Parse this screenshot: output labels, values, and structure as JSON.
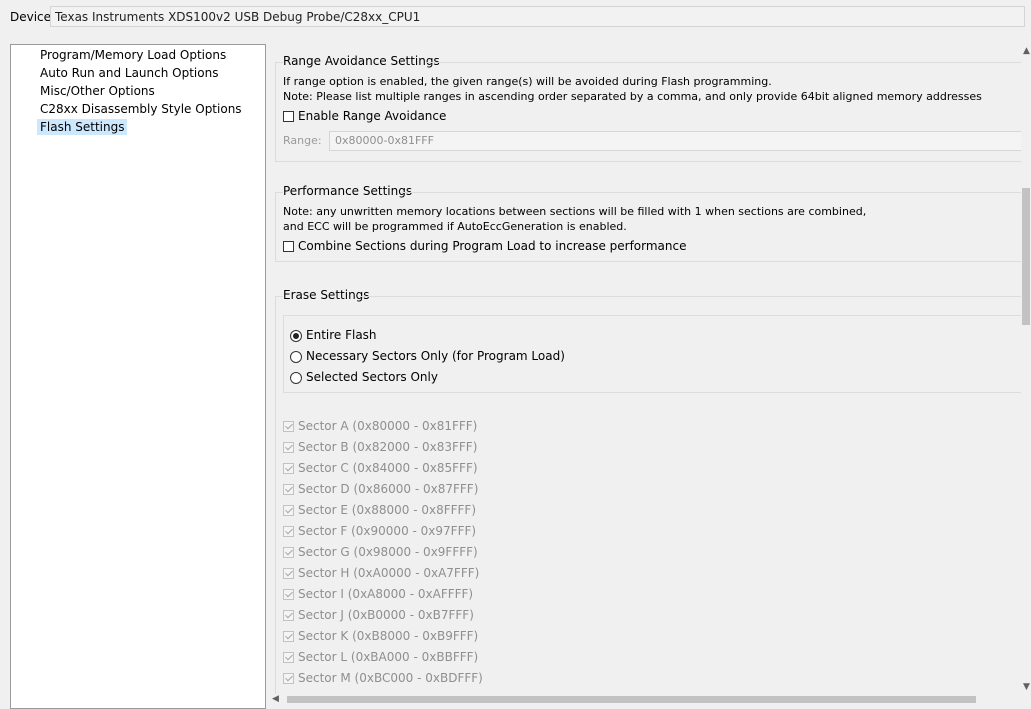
{
  "device": {
    "label": "Device",
    "value": "Texas Instruments XDS100v2 USB Debug Probe/C28xx_CPU1"
  },
  "tree": {
    "items": [
      {
        "label": "Program/Memory Load Options"
      },
      {
        "label": "Auto Run and Launch Options"
      },
      {
        "label": "Misc/Other Options"
      },
      {
        "label": "C28xx Disassembly Style Options"
      },
      {
        "label": "Flash Settings"
      }
    ]
  },
  "range_avoidance": {
    "title": "Range Avoidance Settings",
    "line1": "If range option is enabled, the given range(s) will be avoided during Flash programming.",
    "line2": "Note: Please list multiple ranges in ascending order separated by a comma, and only provide 64bit aligned memory addresses",
    "checkbox_label": "Enable Range Avoidance",
    "range_label": "Range:",
    "range_value": "0x80000-0x81FFF"
  },
  "performance": {
    "title": "Performance Settings",
    "line1": "Note: any unwritten memory locations between sections will be filled with 1 when sections are combined,",
    "line2": "and ECC will be programmed if AutoEccGeneration is enabled.",
    "checkbox_label": "Combine Sections during Program Load to increase performance"
  },
  "erase": {
    "title": "Erase Settings",
    "options": [
      {
        "label": "Entire Flash",
        "selected": true
      },
      {
        "label": "Necessary Sectors Only (for Program Load)",
        "selected": false
      },
      {
        "label": "Selected Sectors Only",
        "selected": false
      }
    ],
    "sectors": [
      {
        "label": "Sector A (0x80000 - 0x81FFF)",
        "checked": true
      },
      {
        "label": "Sector B (0x82000 - 0x83FFF)",
        "checked": true
      },
      {
        "label": "Sector C (0x84000 - 0x85FFF)",
        "checked": true
      },
      {
        "label": "Sector D (0x86000 - 0x87FFF)",
        "checked": true
      },
      {
        "label": "Sector E (0x88000 - 0x8FFFF)",
        "checked": true
      },
      {
        "label": "Sector F (0x90000 - 0x97FFF)",
        "checked": true
      },
      {
        "label": "Sector G (0x98000 - 0x9FFFF)",
        "checked": true
      },
      {
        "label": "Sector H (0xA0000 - 0xA7FFF)",
        "checked": true
      },
      {
        "label": "Sector I (0xA8000 - 0xAFFFF)",
        "checked": true
      },
      {
        "label": "Sector J (0xB0000 - 0xB7FFF)",
        "checked": true
      },
      {
        "label": "Sector K (0xB8000 - 0xB9FFF)",
        "checked": true
      },
      {
        "label": "Sector L (0xBA000 - 0xBBFFF)",
        "checked": true
      },
      {
        "label": "Sector M (0xBC000 - 0xBDFFF)",
        "checked": true
      }
    ]
  },
  "icons": {
    "scroll_up": "chevron-up-icon",
    "scroll_down": "chevron-down-icon",
    "scroll_left": "chevron-left-icon"
  }
}
